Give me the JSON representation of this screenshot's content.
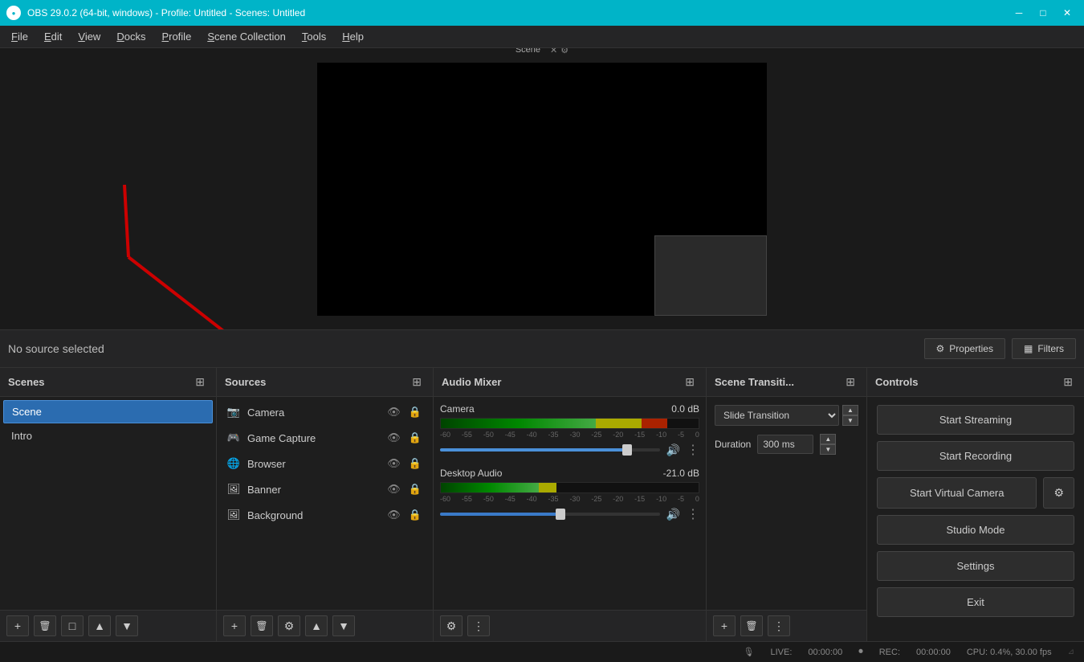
{
  "app": {
    "title": "OBS 29.0.2 (64-bit, windows) - Profile: Untitled - Scenes: Untitled",
    "logo_text": "●"
  },
  "titlebar": {
    "minimize_label": "─",
    "maximize_label": "□",
    "close_label": "✕"
  },
  "menubar": {
    "items": [
      {
        "label": "File",
        "underline_index": 0
      },
      {
        "label": "Edit",
        "underline_index": 0
      },
      {
        "label": "View",
        "underline_index": 0
      },
      {
        "label": "Docks",
        "underline_index": 0
      },
      {
        "label": "Profile",
        "underline_index": 0
      },
      {
        "label": "Scene Collection",
        "underline_index": 0
      },
      {
        "label": "Tools",
        "underline_index": 0
      },
      {
        "label": "Help",
        "underline_index": 0
      }
    ]
  },
  "preview": {
    "label": "Scene"
  },
  "properties_bar": {
    "no_source_label": "No source selected",
    "properties_btn": "Properties",
    "filters_btn": "Filters"
  },
  "scenes_panel": {
    "title": "Scenes",
    "scenes": [
      {
        "name": "Scene",
        "active": true
      },
      {
        "name": "Intro",
        "active": false
      }
    ],
    "footer_btns": [
      "+",
      "🗑",
      "□",
      "▲",
      "▼"
    ]
  },
  "sources_panel": {
    "title": "Sources",
    "sources": [
      {
        "name": "Camera",
        "icon": "📷"
      },
      {
        "name": "Game Capture",
        "icon": "🎮"
      },
      {
        "name": "Browser",
        "icon": "🌐"
      },
      {
        "name": "Banner",
        "icon": "🖼"
      },
      {
        "name": "Background",
        "icon": "🖼"
      }
    ],
    "footer_btns": [
      "+",
      "🗑",
      "⚙",
      "▲",
      "▼"
    ]
  },
  "audio_panel": {
    "title": "Audio Mixer",
    "tracks": [
      {
        "name": "Camera",
        "db": "0.0 dB",
        "level_pct": 78,
        "fader_pct": 85,
        "labels": [
          "-60",
          "-55",
          "-50",
          "-45",
          "-40",
          "-35",
          "-30",
          "-25",
          "-20",
          "-15",
          "-10",
          "-5",
          "0"
        ]
      },
      {
        "name": "Desktop Audio",
        "db": "-21.0 dB",
        "level_pct": 45,
        "fader_pct": 55,
        "labels": [
          "-60",
          "-55",
          "-50",
          "-45",
          "-40",
          "-35",
          "-30",
          "-25",
          "-20",
          "-15",
          "-10",
          "-5",
          "0"
        ]
      }
    ],
    "footer_btns": [
      "⚙",
      "⋮"
    ]
  },
  "transitions_panel": {
    "title": "Scene Transiti...",
    "transition_type": "Slide Transition",
    "duration_label": "Duration",
    "duration_value": "300 ms",
    "footer_btns": [
      "+",
      "🗑",
      "⋮"
    ]
  },
  "controls_panel": {
    "title": "Controls",
    "start_streaming": "Start Streaming",
    "start_recording": "Start Recording",
    "start_virtual_camera": "Start Virtual Camera",
    "studio_mode": "Studio Mode",
    "settings": "Settings",
    "exit": "Exit"
  },
  "statusbar": {
    "live_icon": "🎙",
    "live_label": "LIVE:",
    "live_time": "00:00:00",
    "rec_icon": "⏺",
    "rec_label": "REC:",
    "rec_time": "00:00:00",
    "cpu_label": "CPU: 0.4%, 30.00 fps"
  }
}
